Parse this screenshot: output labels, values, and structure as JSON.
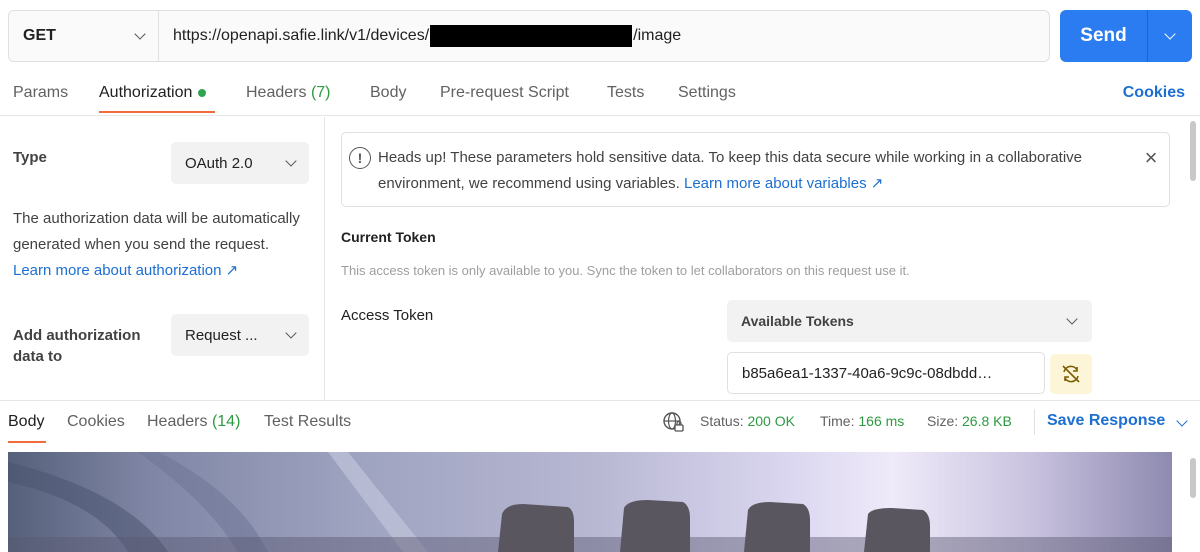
{
  "request": {
    "method": "GET",
    "url_prefix": "https://openapi.safie.link/v1/devices/",
    "url_suffix": "/image",
    "send_label": "Send"
  },
  "request_tabs": {
    "params": "Params",
    "authorization": "Authorization",
    "headers": "Headers",
    "headers_count": "(7)",
    "body": "Body",
    "prerequest": "Pre-request Script",
    "tests": "Tests",
    "settings": "Settings",
    "cookies": "Cookies"
  },
  "auth": {
    "type_label": "Type",
    "type_value": "OAuth 2.0",
    "description": "The authorization data will be automatically generated when you send the request.",
    "learn_more": "Learn more about authorization ↗",
    "add_to_label": "Add authorization data to",
    "add_to_value": "Request ..."
  },
  "notice": {
    "text": "Heads up! These parameters hold sensitive data. To keep this data secure while working in a collaborative environment, we recommend using variables.",
    "link": "Learn more about variables ↗"
  },
  "current_token": {
    "title": "Current Token",
    "hint": "This access token is only available to you. Sync the token to let collaborators on this request use it.",
    "access_token_label": "Access Token",
    "tokens_dropdown": "Available Tokens",
    "token_value": "b85a6ea1-1337-40a6-9c9c-08dbdd…"
  },
  "response": {
    "tabs": {
      "body": "Body",
      "cookies": "Cookies",
      "headers": "Headers",
      "headers_count": "(14)",
      "test_results": "Test Results"
    },
    "status_label": "Status:",
    "status_value": "200 OK",
    "time_label": "Time:",
    "time_value": "166 ms",
    "size_label": "Size:",
    "size_value": "26.8 KB",
    "save_response": "Save Response"
  },
  "colors": {
    "accent": "#2a7cf0",
    "tab_underline": "#f26b3a",
    "success": "#2e9a41",
    "link": "#1d6fd1"
  }
}
